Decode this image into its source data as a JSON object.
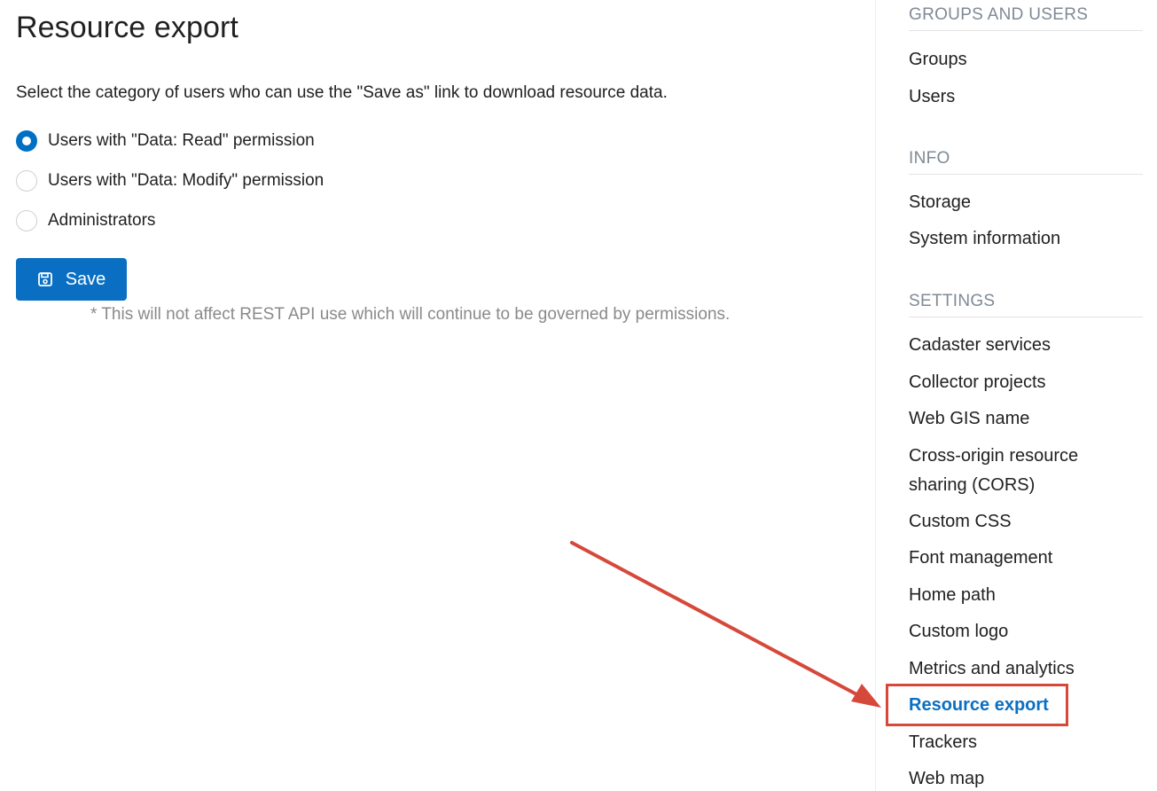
{
  "page": {
    "title": "Resource export",
    "description": "Select the category of users who can use the \"Save as\" link to download resource data.",
    "options": [
      {
        "label": "Users with \"Data: Read\" permission",
        "selected": true
      },
      {
        "label": "Users with \"Data: Modify\" permission",
        "selected": false
      },
      {
        "label": "Administrators",
        "selected": false
      }
    ],
    "save_label": "Save",
    "footnote": "* This will not affect REST API use which will continue to be governed by permissions."
  },
  "sidebar": {
    "sections": [
      {
        "header": "GROUPS AND USERS",
        "items": [
          "Groups",
          "Users"
        ]
      },
      {
        "header": "INFO",
        "items": [
          "Storage",
          "System information"
        ]
      },
      {
        "header": "SETTINGS",
        "items": [
          "Cadaster services",
          "Collector projects",
          "Web GIS name",
          "Cross-origin resource sharing (CORS)",
          "Custom CSS",
          "Font management",
          "Home path",
          "Custom logo",
          "Metrics and analytics",
          "Resource export",
          "Trackers",
          "Web map"
        ]
      }
    ],
    "active_item": "Resource export"
  },
  "annotation": {
    "arrow_color": "#d6493a",
    "highlight_target": "Resource export"
  },
  "colors": {
    "accent": "#0a6fc2",
    "annotation": "#d6493a",
    "muted": "#8a8a8a"
  }
}
